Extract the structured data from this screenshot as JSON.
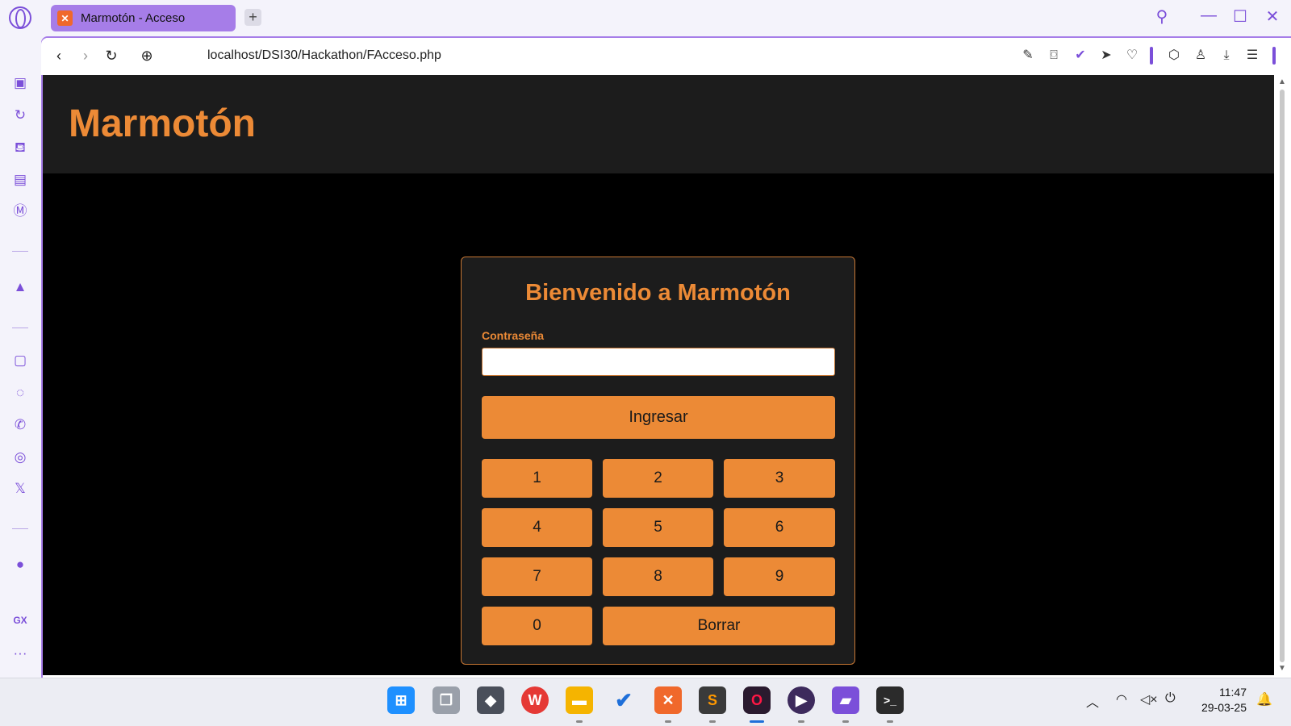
{
  "browser": {
    "tab_title": "Marmotón - Acceso",
    "new_tab": "+",
    "url": "localhost/DSI30/Hackathon/FAcceso.php",
    "window_controls": [
      "search-icon",
      "minimize-icon",
      "maximize-icon",
      "close-icon"
    ],
    "nav_icons": [
      "back-icon",
      "forward-icon",
      "reload-icon",
      "site-info-icon"
    ],
    "toolbar_icons": [
      "snapshot-edit-icon",
      "camera-icon",
      "vpn-icon",
      "send-icon",
      "heart-icon",
      "box-icon",
      "profile-icon",
      "download-icon",
      "easy-setup-icon"
    ],
    "sidebar_icons": [
      "gx-corner-icon",
      "speed-dial-icon",
      "bath-icon",
      "hot-tabs-icon",
      "music-icon",
      "aria-icon",
      "twitch-icon",
      "messenger-icon",
      "whatsapp-icon",
      "instagram-icon",
      "x-icon",
      "player-icon"
    ],
    "sidebar_gx": "GX",
    "sidebar_more": "···"
  },
  "page": {
    "site_title": "Marmotón",
    "welcome": "Bienvenido a Marmotón",
    "password_label": "Contraseña",
    "password_value": "",
    "login_button": "Ingresar",
    "keypad": [
      "1",
      "2",
      "3",
      "4",
      "5",
      "6",
      "7",
      "8",
      "9",
      "0"
    ],
    "clear_button": "Borrar"
  },
  "taskbar": {
    "apps": [
      "windows-start-icon",
      "task-view-icon",
      "unity-icon",
      "wps-office-icon",
      "file-explorer-icon",
      "todo-icon",
      "xampp-icon",
      "sublime-text-icon",
      "opera-gx-icon",
      "media-player-icon",
      "clipchamp-icon",
      "terminal-icon"
    ],
    "tray_icons": [
      "chevron-up-icon",
      "wifi-icon",
      "mute-icon",
      "battery-icon"
    ],
    "time": "11:47",
    "date": "29-03-25"
  }
}
